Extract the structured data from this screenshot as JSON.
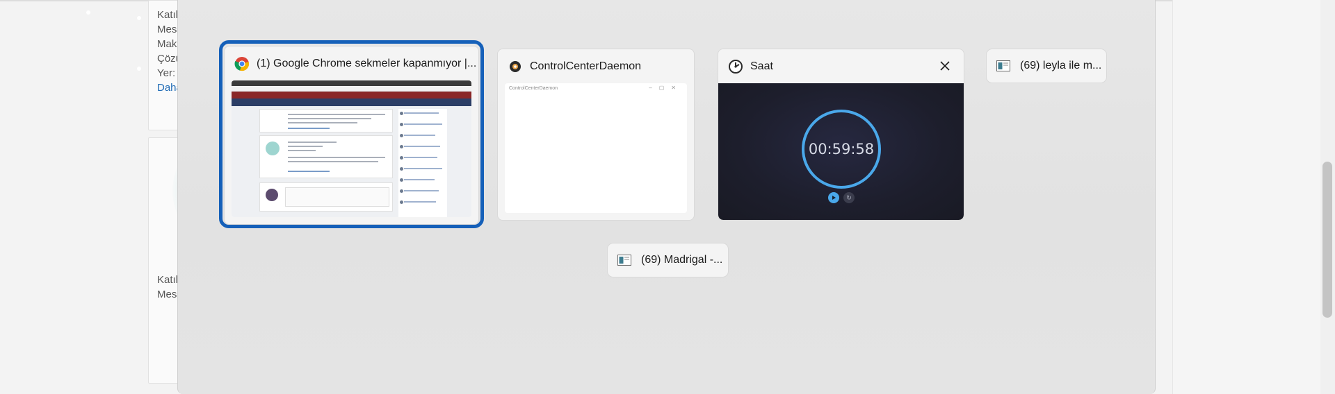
{
  "background_page": {
    "card1_lines": [
      "Katıl",
      "Mes",
      "Mak",
      "Çözü",
      "Yer:"
    ],
    "card1_link": "Daha",
    "card2_lines": [
      "Katıl",
      "Mes"
    ]
  },
  "switcher": {
    "windows": [
      {
        "title": "(1) Google Chrome sekmeler kapanmıyor |...",
        "icon": "chrome-icon",
        "selected": true
      },
      {
        "title": "ControlCenterDaemon",
        "icon": "control-center-icon",
        "thumb_title": "ControlCenterDaemon",
        "thumb_controls": "–▢✕"
      },
      {
        "title": "Saat",
        "icon": "clock-app-icon",
        "time": "00:59:58"
      },
      {
        "title": "(69) leyla ile m...",
        "icon": "window-icon"
      },
      {
        "title": "(69) Madrigal -...",
        "icon": "window-icon"
      }
    ]
  },
  "colors": {
    "selection": "#1560b9",
    "clock_accent": "#4aa8ea"
  }
}
